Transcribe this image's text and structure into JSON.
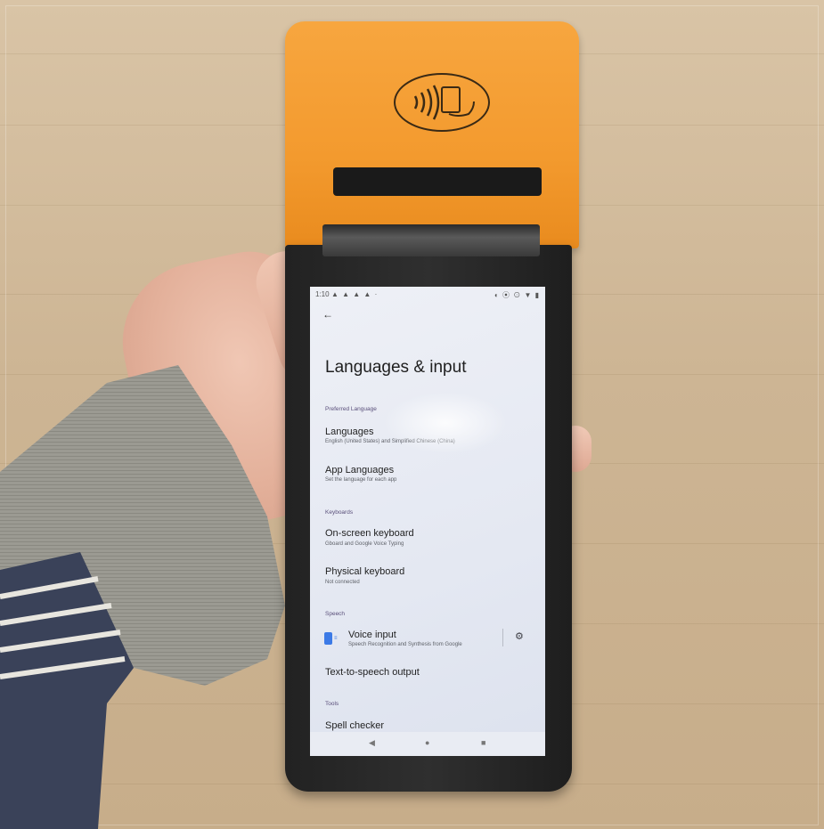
{
  "device": {
    "status_bar": {
      "time": "1:10",
      "left_icons": "▲ ▲ ▲ ▲ ·",
      "right_icons": "◐ ⦿ ⊙ ▼ ▮"
    },
    "screen": {
      "title": "Languages & input",
      "sections": [
        {
          "header": "Preferred Language",
          "items": [
            {
              "title": "Languages",
              "subtitle": "English (United States) and Simplified Chinese (China)"
            },
            {
              "title": "App Languages",
              "subtitle": "Set the language for each app"
            }
          ]
        },
        {
          "header": "Keyboards",
          "items": [
            {
              "title": "On-screen keyboard",
              "subtitle": "Gboard and Google Voice Typing"
            },
            {
              "title": "Physical keyboard",
              "subtitle": "Not connected"
            }
          ]
        },
        {
          "header": "Speech",
          "items": [
            {
              "title": "Voice input",
              "subtitle": "Speech Recognition and Synthesis from Google"
            },
            {
              "title": "Text-to-speech output",
              "subtitle": ""
            }
          ]
        },
        {
          "header": "Tools",
          "items": [
            {
              "title": "Spell checker",
              "subtitle": ""
            }
          ]
        }
      ]
    },
    "icons": {
      "back": "←",
      "settings": "⚙",
      "nav_back": "◀",
      "nav_home": "●",
      "nav_recents": "■"
    },
    "colors": {
      "printer_cap": "#f39a2e",
      "screen_bg": "#e6e9f2",
      "section_header": "#5a4f7a",
      "voice_icon": "#3c7ae6"
    }
  }
}
